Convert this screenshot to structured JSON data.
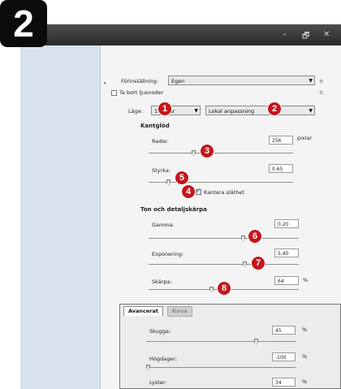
{
  "step_number": "2",
  "window": {
    "controls": [
      "–",
      "🗗",
      "✕"
    ]
  },
  "settings": {
    "preset_label": "Förinställning:",
    "preset_value": "Egen",
    "hide_nodes_label": "Ta bort ljusnoder",
    "mode_label": "Läge:",
    "bit_mode_value": "16 bitar",
    "method_value": "Lokal anpassning"
  },
  "edge_glow": {
    "heading": "Kantglöd",
    "radius_label": "Radie:",
    "radius_value": "256",
    "radius_unit": "pixlar",
    "strength_label": "Styrka:",
    "strength_value": "0.65",
    "smooth_edges_label": "Kantera släthet"
  },
  "tone_detail": {
    "heading": "Ton och detaljskärpa",
    "gamma_label": "Gamma:",
    "gamma_value": "0.20",
    "exposure_label": "Exponering:",
    "exposure_value": "5.40",
    "sharpness_label": "Skärpa:",
    "sharpness_value": "64",
    "sharpness_unit": "%"
  },
  "tabs": {
    "active": "Avancerat",
    "inactive": "Kurva"
  },
  "advanced": {
    "shadow_label": "Skugga:",
    "shadow_value": "45",
    "highlight_label": "Högdager:",
    "highlight_value": "-100",
    "vibrance_label": "Lyster:",
    "vibrance_value": "34",
    "unit": "%"
  },
  "badges": [
    "1",
    "2",
    "3",
    "4",
    "5",
    "6",
    "7",
    "8"
  ],
  "colors": {
    "badge": "#c4161c",
    "titlebar": "#333333",
    "sidebar": "#d7e2ee"
  }
}
